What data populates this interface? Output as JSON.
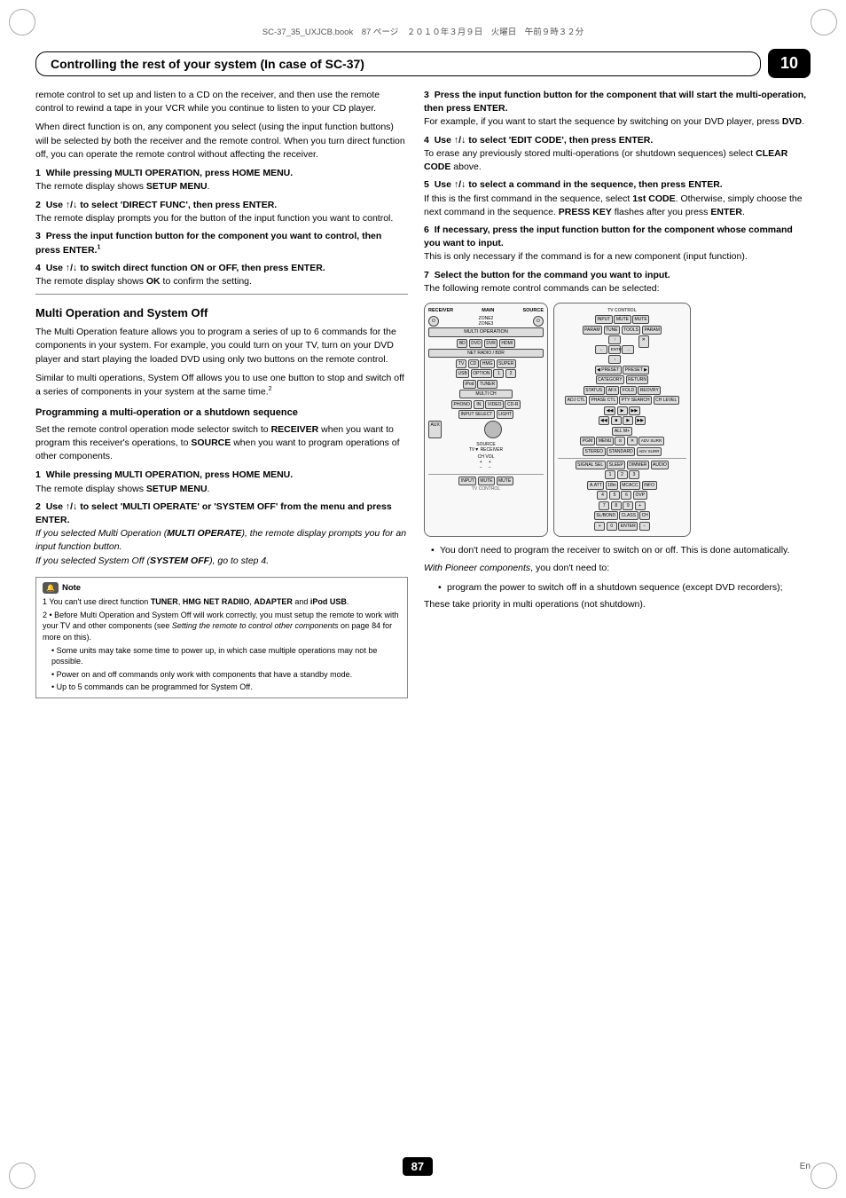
{
  "file_info": "SC-37_35_UXJCB.book　87 ページ　２０１０年３月９日　火曜日　午前９時３２分",
  "chapter": {
    "title": "Controlling the rest of your system (In case of SC-37)",
    "number": "10"
  },
  "left_col": {
    "intro_paras": [
      "remote control to set up and listen to a CD on the receiver, and then use the remote control to rewind a tape in your VCR while you continue to listen to your CD player.",
      "When direct function is on, any component you select (using the input function buttons) will be selected by both the receiver and the remote control. When you turn direct function off, you can operate the remote control without affecting the receiver."
    ],
    "steps_initial": [
      {
        "num": "1",
        "bold_part": "While pressing MULTI OPERATION, press HOME MENU.",
        "normal_part": "",
        "sub": "The remote display shows SETUP MENU."
      },
      {
        "num": "2",
        "bold_part": "Use ↑/↓ to select 'DIRECT FUNC', then press ENTER.",
        "normal_part": "",
        "sub": "The remote display prompts you for the button of the input function you want to control."
      },
      {
        "num": "3",
        "bold_part": "Press the input function button for the component you want to control, then press ENTER.",
        "sup": "1",
        "normal_part": "",
        "sub": ""
      },
      {
        "num": "4",
        "bold_part": "Use ↑/↓ to switch direct function ON or OFF, then press ENTER.",
        "normal_part": "",
        "sub": "The remote display shows OK to confirm the setting."
      }
    ],
    "section_title": "Multi Operation and System Off",
    "section_paras": [
      "The Multi Operation feature allows you to program a series of up to 6 commands for the components in your system. For example, you could turn on your TV, turn on your DVD player and start playing the loaded DVD using only two buttons on the remote control.",
      "Similar to multi operations, System Off allows you to use one button to stop and switch off a series of components in your system at the same time."
    ],
    "sub_section_title": "Programming a multi-operation or a shutdown sequence",
    "sub_section_para": "Set the remote control operation mode selector switch to RECEIVER when you want to program this receiver's operations, to SOURCE when you want to program operations of other components.",
    "steps_multi": [
      {
        "num": "1",
        "bold_part": "While pressing MULTI OPERATION, press HOME MENU.",
        "sub": "The remote display shows SETUP MENU."
      },
      {
        "num": "2",
        "bold_part": "Use ↑/↓ to select 'MULTI OPERATE' or 'SYSTEM OFF' from the menu and press ENTER.",
        "italic_note1": "If you selected Multi Operation (MULTI OPERATE), the remote display prompts you for an input function button.",
        "italic_note2": "If you selected System Off (SYSTEM OFF), go to step 4."
      }
    ]
  },
  "right_col": {
    "steps_right": [
      {
        "num": "3",
        "bold_part": "Press the input function button for the component that will start the multi-operation, then press ENTER.",
        "sub": "For example, if you want to start the sequence by switching on your DVD player, press DVD."
      },
      {
        "num": "4",
        "bold_part": "Use ↑/↓ to select 'EDIT CODE', then press ENTER.",
        "sub": "To erase any previously stored multi-operations (or shutdown sequences) select CLEAR CODE above."
      },
      {
        "num": "5",
        "bold_part": "Use ↑/↓ to select a command in the sequence, then press ENTER.",
        "sub": "If this is the first command in the sequence, select 1st CODE. Otherwise, simply choose the next command in the sequence. PRESS KEY flashes after you press ENTER."
      },
      {
        "num": "6",
        "bold_part": "If necessary, press the input function button for the component whose command you want to input.",
        "sub": "This is only necessary if the command is for a new component (input function)."
      },
      {
        "num": "7",
        "bold_part": "Select the button for the command you want to input.",
        "sub": "The following remote control commands can be selected:"
      }
    ],
    "bullets_after_remote": [
      "You don't need to program the receiver to switch on or off. This is done automatically.",
      "With Pioneer components, you don't need to:",
      "program the power to switch off in a shutdown sequence (except DVD recorders);",
      "These take priority in multi operations (not shutdown)."
    ],
    "with_pioneer_sub": "With Pioneer components, you don't need to:",
    "with_pioneer_bullets": [
      "program the power to switch off in a shutdown sequence (except DVD recorders);"
    ],
    "final_note": "These take priority in multi operations (not shutdown)."
  },
  "note_box": {
    "label": "Note",
    "items": [
      "1 You can't use direct function TUNER, HMG NET RADIIO, ADAPTER and iPod USB.",
      "2 • Before Multi Operation and System Off will work correctly, you must setup the remote to work with your TV and other components (see Setting the remote to control other components on page 84 for more on this).",
      "  • Some units may take some time to power up, in which case multiple operations may not be possible.",
      "  • Power on and off commands only work with components that have a standby mode.",
      "  • Up to 5 commands can be programmed for System Off."
    ]
  },
  "page_footer": {
    "number": "87",
    "lang": "En"
  },
  "remote_left": {
    "header_left": "RECEIVER",
    "header_mid": "MAIN",
    "header_right": "SOURCE",
    "rows": [
      [
        "⏻",
        "ZONE2",
        "ZONE3",
        "⏻"
      ],
      [
        "MULTI OPERATION"
      ],
      [
        "BD",
        "DVD",
        "DVR",
        "HDMI"
      ],
      [
        "NET RADIO"
      ],
      [
        "TV",
        "CD",
        "HMG",
        "SUPER"
      ],
      [
        "USB",
        "OPTION",
        "1",
        "2"
      ],
      [
        "iPod",
        "TUNER",
        ""
      ],
      [
        "MULTI CH"
      ],
      [
        "PHONO",
        "IN",
        "VIDEO",
        "CD-R"
      ],
      [
        "INPUT SELECT",
        "LIGHT"
      ],
      [
        "AUX"
      ]
    ]
  },
  "remote_right": {
    "header": "TV CONTROL",
    "rows_top": [
      [
        "INPUT",
        "MUTE",
        "MUTE"
      ],
      [
        "TUNE",
        "TOOLS"
      ],
      [
        "×",
        "↑",
        ""
      ],
      [
        "←",
        "ENTER",
        "→"
      ],
      [
        "↓",
        ""
      ],
      [
        "PRESET ←",
        "PRESET →"
      ],
      [
        "CATEGORY",
        "RETURN"
      ],
      [
        "STATUS",
        "PHASE CTL",
        "PTY SEARCH",
        "CH LEVEL"
      ],
      [
        "◀◀",
        "▶",
        "▶▶"
      ],
      [
        "◀◀",
        "■",
        "▶",
        "▶▶"
      ],
      [
        "PGM",
        "MENU",
        "⊙",
        "✕"
      ],
      [
        "ADV SURR"
      ]
    ],
    "rows_bottom": [
      [
        "SIGNAL SEL",
        "SLEEP",
        "DIMMER",
        "AUDIO"
      ],
      [
        "1",
        "2",
        "3"
      ],
      [
        "A.ATT",
        "18in",
        "MCACC",
        "INFO"
      ],
      [
        "4",
        "5",
        "6",
        "OVP"
      ],
      [
        "7",
        "8",
        "9",
        "+"
      ],
      [
        "SL/BOND",
        "CLASS",
        "CH"
      ],
      [
        "+",
        "0",
        "ENTER",
        "−"
      ]
    ]
  }
}
